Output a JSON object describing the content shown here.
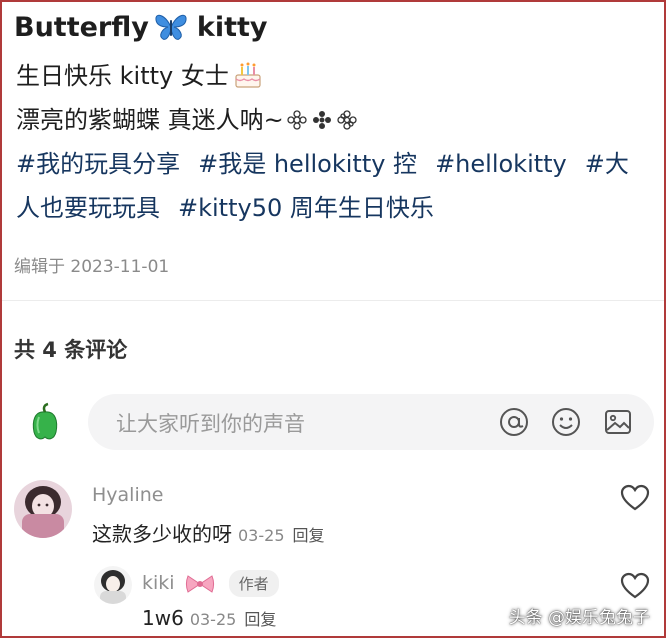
{
  "post": {
    "title_part1": "Butterfly",
    "title_part2": "kitty",
    "title_icon": "blue-butterfly-emoji",
    "line1": "生日快乐 kitty 女士",
    "line1_icon": "birthday-cake-emoji",
    "line2": "漂亮的紫蝴蝶 真迷人呐~",
    "line2_icon": "flower-emojis",
    "tags": [
      "#我的玩具分享",
      "#我是 hellokitty 控",
      "#hellokitty",
      "#大"
    ],
    "tags_line2": [
      "人也要玩玩具",
      "#kitty50 周年生日快乐"
    ],
    "edited": "编辑于 2023-11-01"
  },
  "comments_section": {
    "count_label": "共 4 条评论",
    "composer_placeholder": "让大家听到你的声音",
    "composer_icons": [
      "at-icon",
      "emoji-icon",
      "image-icon"
    ]
  },
  "comments": [
    {
      "user": "Hyaline",
      "text": "这款多少收的呀",
      "date": "03-25",
      "reply_label": "回复"
    },
    {
      "user": "kiki",
      "badge": "作者",
      "text": "1w6",
      "date": "03-25",
      "reply_label": "回复"
    }
  ],
  "watermark": "头条 @娱乐兔兔子",
  "colors": {
    "tag": "#16365f",
    "frame_border": "#b03a3a",
    "meta": "#888888"
  }
}
